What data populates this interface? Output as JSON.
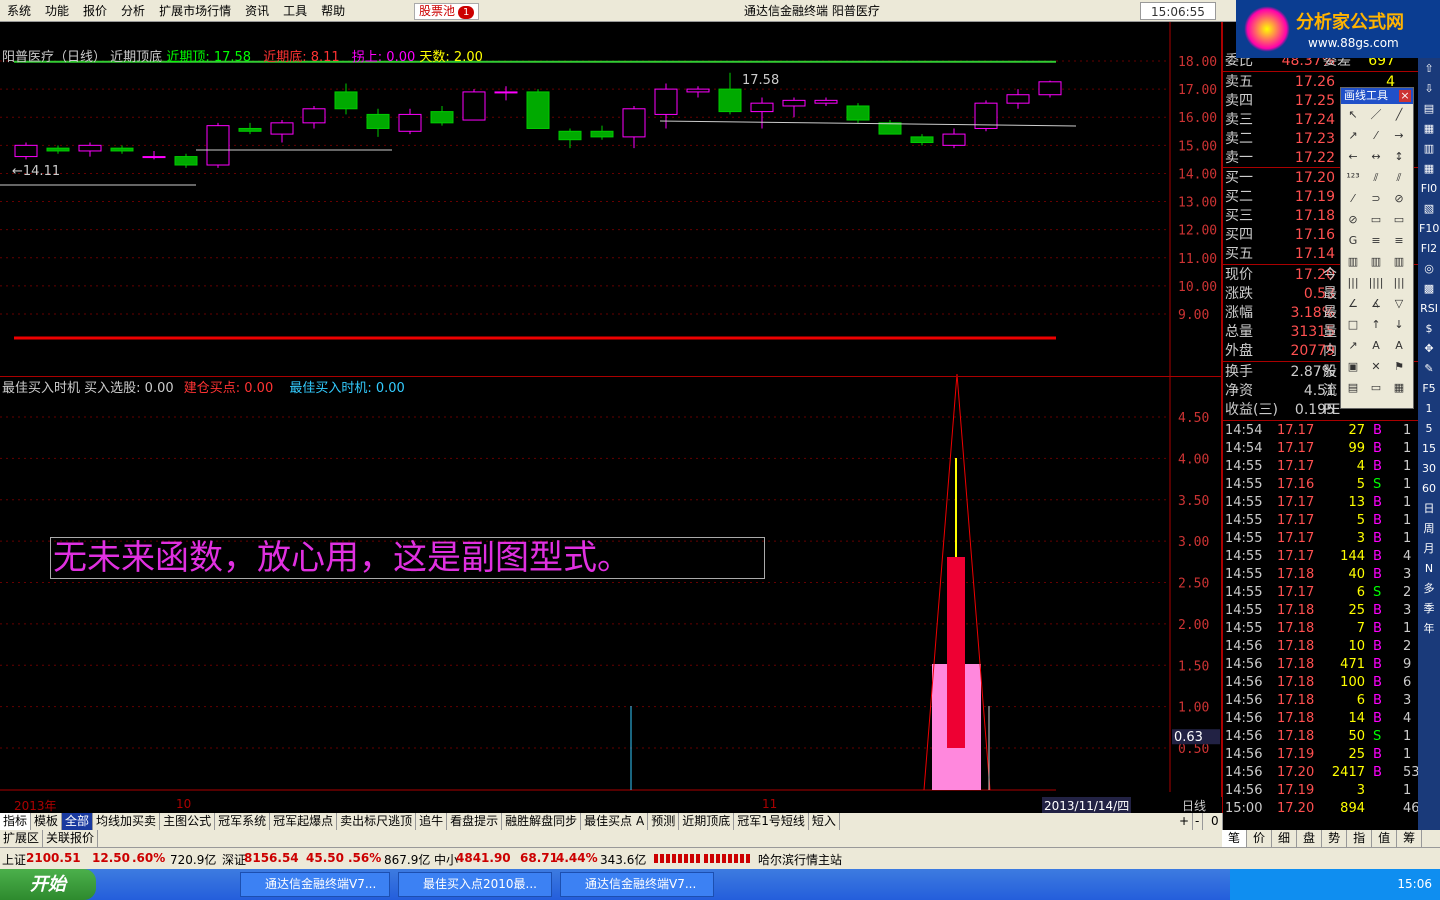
{
  "menu": {
    "items": [
      "系统",
      "功能",
      "报价",
      "分析",
      "扩展市场行情",
      "资讯",
      "工具",
      "帮助"
    ],
    "stock_pool": "股票池",
    "stock_pool_count": "1",
    "window_title": "通达信金融终端   阳普医疗",
    "clock": "15:06:55"
  },
  "logo": {
    "text": "分析家公式网",
    "url": "www.88gs.com"
  },
  "main_chart": {
    "name": "阳普医疗（日线）",
    "indicator": "近期顶底",
    "recent_top_label": "近期顶: 17.58",
    "recent_bottom_label": "近期底: 8.11",
    "bounce_label": "拐上: 0.00",
    "days_label": "天数: 2.00",
    "high_marker": "17.58",
    "low_marker": "←14.11",
    "yticks": [
      "18.00",
      "17.00",
      "16.00",
      "15.00",
      "14.00",
      "13.00",
      "12.00",
      "11.00",
      "10.00",
      "9.00"
    ]
  },
  "sub_chart": {
    "indicator_name": "最佳买入时机",
    "select_label": "买入选股: 0.00",
    "build_label": "建仓买点: 0.00",
    "best_label": "最佳买入时机: 0.00",
    "yticks": [
      "4.50",
      "4.00",
      "3.50",
      "3.00",
      "2.50",
      "2.00",
      "1.50",
      "1.00",
      "0.50"
    ],
    "current_value": "0.63",
    "annotation": "无未来函数，放心用，这是副图型式。"
  },
  "chart_data": {
    "type": "candlestick",
    "candles": [
      {
        "o": 14.6,
        "c": 15.0,
        "h": 15.1,
        "l": 14.5
      },
      {
        "o": 14.9,
        "c": 14.8,
        "h": 15.0,
        "l": 14.7
      },
      {
        "o": 14.8,
        "c": 15.0,
        "h": 15.1,
        "l": 14.6
      },
      {
        "o": 14.9,
        "c": 14.8,
        "h": 15.0,
        "l": 14.7
      },
      {
        "o": 14.6,
        "c": 14.6,
        "h": 14.8,
        "l": 14.5
      },
      {
        "o": 14.6,
        "c": 14.3,
        "h": 14.7,
        "l": 14.2
      },
      {
        "o": 14.3,
        "c": 15.7,
        "h": 15.8,
        "l": 14.2
      },
      {
        "o": 15.6,
        "c": 15.5,
        "h": 15.8,
        "l": 15.4
      },
      {
        "o": 15.4,
        "c": 15.8,
        "h": 15.9,
        "l": 15.1
      },
      {
        "o": 15.8,
        "c": 16.3,
        "h": 16.4,
        "l": 15.6
      },
      {
        "o": 16.9,
        "c": 16.3,
        "h": 17.2,
        "l": 16.1
      },
      {
        "o": 16.1,
        "c": 15.6,
        "h": 16.3,
        "l": 15.3
      },
      {
        "o": 15.5,
        "c": 16.1,
        "h": 16.3,
        "l": 15.4
      },
      {
        "o": 16.2,
        "c": 15.8,
        "h": 16.4,
        "l": 15.7
      },
      {
        "o": 15.9,
        "c": 16.9,
        "h": 17.0,
        "l": 15.9
      },
      {
        "o": 16.9,
        "c": 16.9,
        "h": 17.1,
        "l": 16.6
      },
      {
        "o": 16.9,
        "c": 15.6,
        "h": 17.0,
        "l": 15.6
      },
      {
        "o": 15.5,
        "c": 15.2,
        "h": 15.6,
        "l": 14.9
      },
      {
        "o": 15.5,
        "c": 15.3,
        "h": 15.7,
        "l": 15.2
      },
      {
        "o": 15.3,
        "c": 16.3,
        "h": 16.4,
        "l": 14.9
      },
      {
        "o": 16.1,
        "c": 17.0,
        "h": 17.2,
        "l": 15.6
      },
      {
        "o": 16.9,
        "c": 17.0,
        "h": 17.1,
        "l": 16.7
      },
      {
        "o": 17.0,
        "c": 16.2,
        "h": 17.58,
        "l": 16.1
      },
      {
        "o": 16.2,
        "c": 16.5,
        "h": 16.7,
        "l": 15.6
      },
      {
        "o": 16.4,
        "c": 16.6,
        "h": 16.7,
        "l": 16.0
      },
      {
        "o": 16.5,
        "c": 16.6,
        "h": 16.7,
        "l": 16.4
      },
      {
        "o": 16.4,
        "c": 15.9,
        "h": 16.5,
        "l": 15.8
      },
      {
        "o": 15.8,
        "c": 15.4,
        "h": 15.9,
        "l": 15.4
      },
      {
        "o": 15.3,
        "c": 15.1,
        "h": 15.4,
        "l": 15.0
      },
      {
        "o": 15.0,
        "c": 15.4,
        "h": 15.6,
        "l": 14.9
      },
      {
        "o": 15.6,
        "c": 16.5,
        "h": 16.6,
        "l": 15.5
      },
      {
        "o": 16.5,
        "c": 16.8,
        "h": 17.0,
        "l": 16.3
      },
      {
        "o": 16.8,
        "c": 17.26,
        "h": 17.3,
        "l": 16.7
      }
    ],
    "recent_top": 17.58,
    "recent_bottom": 8.11
  },
  "date_axis": {
    "year": "2013年",
    "m1": "10",
    "m2": "11",
    "current": "2013/11/14/四",
    "period": "日线"
  },
  "tabs": [
    "指标",
    "模板",
    "全部",
    "均线加买卖",
    "主图公式",
    "冠军系统",
    "冠军起爆点",
    "卖出标尺逃顶",
    "追牛",
    "看盘提示",
    "融胜解盘同步",
    "最佳买点 A",
    "预测",
    "近期顶底",
    "冠军1号短线",
    "短入"
  ],
  "tabs2": [
    "扩展区",
    "关联报价"
  ],
  "rtabs": [
    "笔",
    "价",
    "细",
    "盘",
    "势",
    "指",
    "值",
    "筹"
  ],
  "quote": {
    "header_label": "委比",
    "header_val": "48.37%",
    "header_ext": "委差",
    "header_num": "697",
    "asks": [
      {
        "l": "卖五",
        "p": "17.26",
        "v": "4"
      },
      {
        "l": "卖四",
        "p": "17.25",
        "v": ""
      },
      {
        "l": "卖三",
        "p": "17.24",
        "v": ""
      },
      {
        "l": "卖二",
        "p": "17.23",
        "v": ""
      },
      {
        "l": "卖一",
        "p": "17.22",
        "v": ""
      }
    ],
    "bids": [
      {
        "l": "买一",
        "p": "17.20",
        "v": ""
      },
      {
        "l": "买二",
        "p": "17.19",
        "v": ""
      },
      {
        "l": "买三",
        "p": "17.18",
        "v": ""
      },
      {
        "l": "买四",
        "p": "17.16",
        "v": ""
      },
      {
        "l": "买五",
        "p": "17.14",
        "v": ""
      }
    ],
    "stats": [
      {
        "l": "现价",
        "v": "17.20",
        "e": "今"
      },
      {
        "l": "涨跌",
        "v": "0.53",
        "e": "最"
      },
      {
        "l": "涨幅",
        "v": "3.18%",
        "e": "最"
      },
      {
        "l": "总量",
        "v": "31315",
        "e": "量"
      },
      {
        "l": "外盘",
        "v": "20779",
        "e": "内"
      }
    ],
    "stats2": [
      {
        "l": "换手",
        "v": "2.87%",
        "e": "股"
      },
      {
        "l": "净资",
        "v": "4.51",
        "e": "流"
      },
      {
        "l": "收益(三)",
        "v": "0.195",
        "e": "PE"
      }
    ]
  },
  "ticks": [
    [
      "14:54",
      "17.17",
      "27",
      "B",
      "1"
    ],
    [
      "14:54",
      "17.17",
      "99",
      "B",
      "1"
    ],
    [
      "14:55",
      "17.17",
      "4",
      "B",
      "1"
    ],
    [
      "14:55",
      "17.16",
      "5",
      "S",
      "1"
    ],
    [
      "14:55",
      "17.17",
      "13",
      "B",
      "1"
    ],
    [
      "14:55",
      "17.17",
      "5",
      "B",
      "1"
    ],
    [
      "14:55",
      "17.17",
      "3",
      "B",
      "1"
    ],
    [
      "14:55",
      "17.17",
      "144",
      "B",
      "4"
    ],
    [
      "14:55",
      "17.18",
      "40",
      "B",
      "3"
    ],
    [
      "14:55",
      "17.17",
      "6",
      "S",
      "2"
    ],
    [
      "14:55",
      "17.18",
      "25",
      "B",
      "3"
    ],
    [
      "14:55",
      "17.18",
      "7",
      "B",
      "1"
    ],
    [
      "14:56",
      "17.18",
      "10",
      "B",
      "2"
    ],
    [
      "14:56",
      "17.18",
      "471",
      "B",
      "9"
    ],
    [
      "14:56",
      "17.18",
      "100",
      "B",
      "6"
    ],
    [
      "14:56",
      "17.18",
      "6",
      "B",
      "3"
    ],
    [
      "14:56",
      "17.18",
      "14",
      "B",
      "4"
    ],
    [
      "14:56",
      "17.18",
      "50",
      "S",
      "1"
    ],
    [
      "14:56",
      "17.19",
      "25",
      "B",
      "1"
    ],
    [
      "14:56",
      "17.20",
      "2417",
      "B",
      "53"
    ],
    [
      "14:56",
      "17.19",
      "3",
      "",
      "1"
    ],
    [
      "15:00",
      "17.20",
      "894",
      "",
      "46"
    ]
  ],
  "drawtools": {
    "title": "画线工具"
  },
  "side_icons": [
    "⇧",
    "⇩",
    "▤",
    "▦",
    "▥",
    "▦",
    "Fl0",
    "▧",
    "F10",
    "Fl2",
    "◎",
    "▩",
    "RSI",
    "$",
    "✥",
    "✎",
    "F5",
    "1",
    "5",
    "15",
    "30",
    "60",
    "日",
    "周",
    "月",
    "N",
    "多",
    "季",
    "年"
  ],
  "status": {
    "sh": "上证",
    "sh_val": "2100.51",
    "sh_chg": "12.50",
    "sh_pct": ".60%",
    "sh_amt": "720.9亿",
    "sz": "深证",
    "sz_val": "8156.54",
    "sz_chg": "45.50",
    "sz_pct": ".56%",
    "sz_amt": "867.9亿",
    "zx": "中小",
    "zx_val": "4841.90",
    "zx_chg": "68.71",
    "zx_pct": "4.44%",
    "zx_amt": "343.6亿",
    "station": "哈尔滨行情主站"
  },
  "taskbar": {
    "start": "开始",
    "t1": "通达信金融终端V7...",
    "t2": "最佳买入点2010最...",
    "t3": "通达信金融终端V7...",
    "time": "15:06"
  }
}
